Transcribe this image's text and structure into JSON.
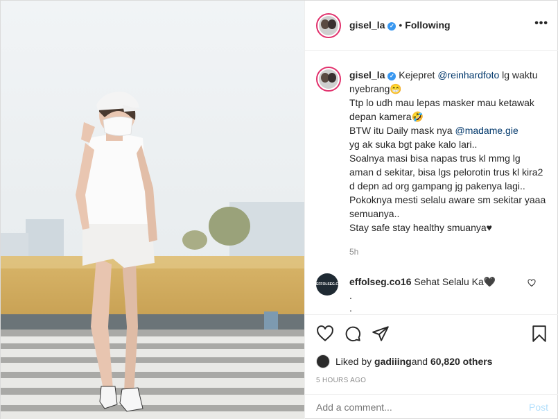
{
  "post": {
    "username": "gisel_la",
    "follow_separator": "•",
    "follow_state": "Following",
    "more_label": "•••"
  },
  "caption": {
    "username": "gisel_la",
    "lines": [
      "Kejepret ",
      "@reinhardfoto",
      " lg waktu nyebrang😁",
      "Ttp lo udh mau lepas masker mau ketawak depan kamera🤣",
      "BTW itu Daily mask nya ",
      "@madame.gie",
      "yg ak suka bgt pake kalo lari..",
      "Soalnya masi bisa napas trus kl mmg lg aman d sekitar, bisa lgs pelorotin trus kl kira2 d depn ad org gampang jg pakenya lagi..",
      "Pokoknya mesti selalu aware sm sekitar yaaa semuanya..",
      "Stay safe stay healthy smuanya♥"
    ],
    "age": "5h"
  },
  "comment": {
    "avatar_text": "EFFOLSEG.CO",
    "username": "effolseg.co16",
    "text": "Sehat Selalu Ka🖤",
    "extra": ".",
    "extra2": "."
  },
  "likes": {
    "prefix": "Liked by ",
    "user": "gadiiing",
    "middle": " and ",
    "count": "60,820 others"
  },
  "timestamp": "5 HOURS AGO",
  "add_comment": {
    "placeholder": "Add a comment...",
    "post_label": "Post"
  },
  "colors": {
    "accent": "#3897f0",
    "mention": "#00376b",
    "muted": "#8e8e8e",
    "post_disabled": "#b2dffc"
  },
  "icons": [
    "heart-icon",
    "comment-icon",
    "share-icon",
    "bookmark-icon",
    "verified-icon",
    "more-icon"
  ]
}
